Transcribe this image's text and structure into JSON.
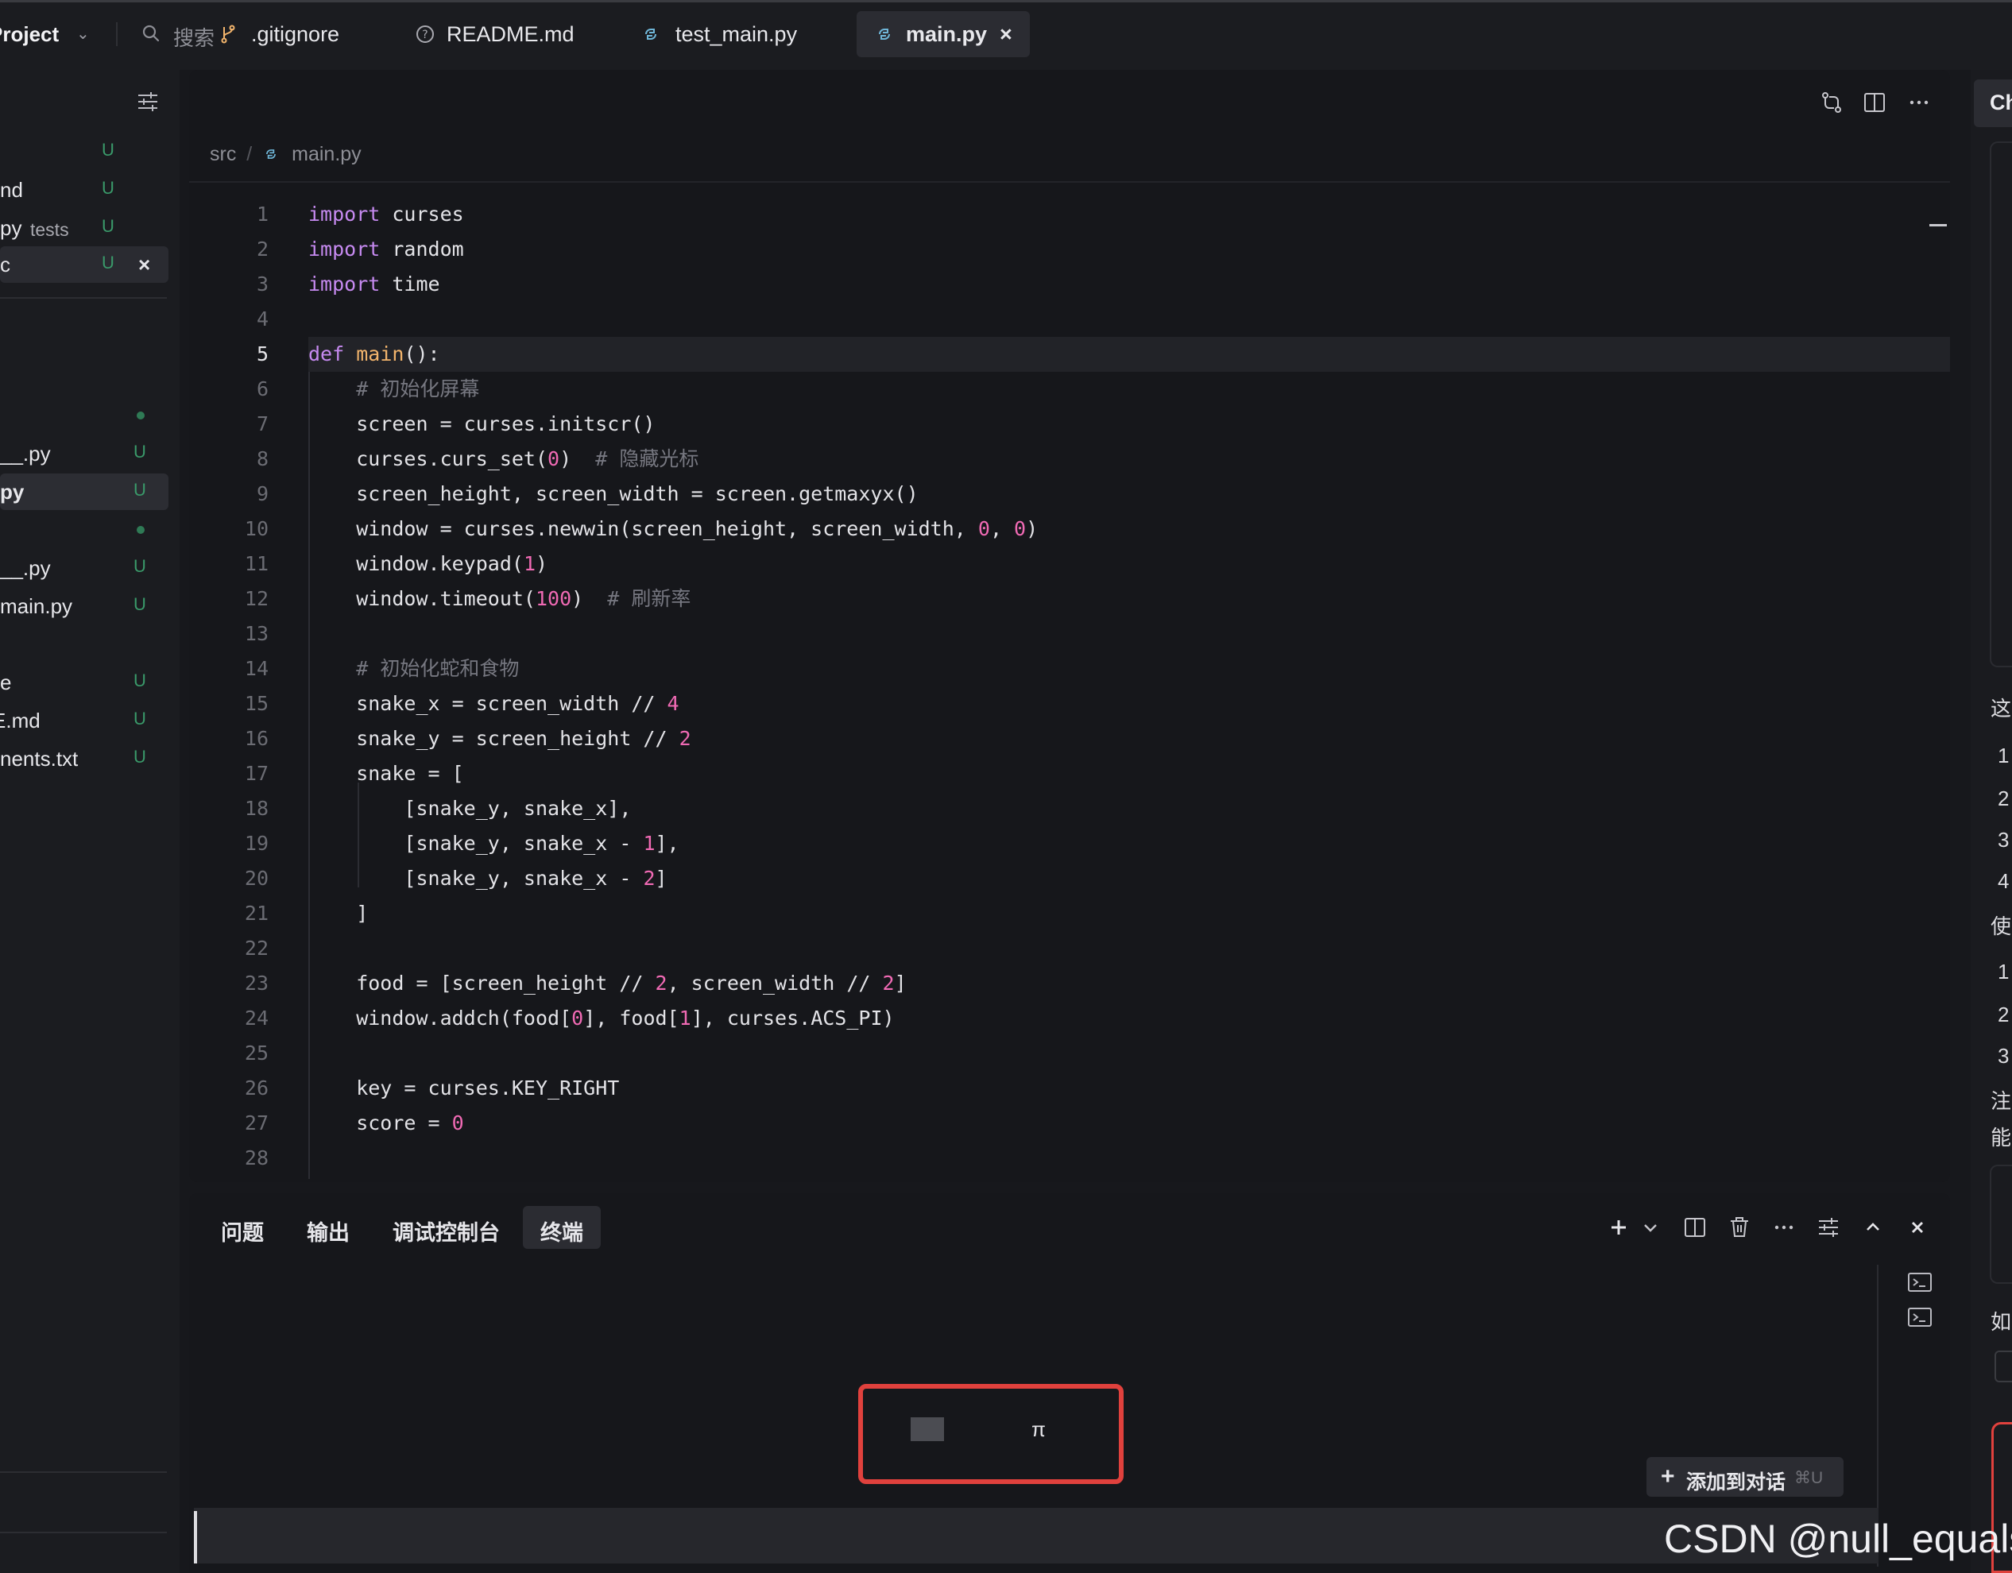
{
  "topbar": {
    "project": "Project",
    "search_placeholder": "搜索"
  },
  "sidebar": {
    "items": [
      {
        "name": "",
        "status": "U"
      },
      {
        "name": "nd",
        "status": "U"
      },
      {
        "name": "py",
        "sub": "tests",
        "status": "U"
      },
      {
        "name": "c",
        "status": "U",
        "close": "×"
      },
      {
        "name": "__.py",
        "status": "U"
      },
      {
        "name": "py",
        "status": "U"
      },
      {
        "name": "__.py",
        "status": "U"
      },
      {
        "name": "main.py",
        "status": "U"
      },
      {
        "name": "e",
        "status": "U"
      },
      {
        "name": "E.md",
        "status": "U"
      },
      {
        "name": "nents.txt",
        "status": "U"
      }
    ]
  },
  "editor": {
    "tabs": [
      {
        "label": ".gitignore",
        "icon": "git-branch-icon"
      },
      {
        "label": "README.md",
        "icon": "info-circle-icon"
      },
      {
        "label": "test_main.py",
        "icon": "python-icon"
      },
      {
        "label": "main.py",
        "icon": "python-icon",
        "close": "×"
      }
    ],
    "breadcrumb": {
      "folder": "src",
      "sep": "/",
      "file": "main.py"
    },
    "current_line": 5,
    "lines": [
      [
        {
          "t": "k",
          "v": "import"
        },
        {
          "t": "p",
          "v": " curses"
        }
      ],
      [
        {
          "t": "k",
          "v": "import"
        },
        {
          "t": "p",
          "v": " random"
        }
      ],
      [
        {
          "t": "k",
          "v": "import"
        },
        {
          "t": "p",
          "v": " time"
        }
      ],
      [],
      [
        {
          "t": "k",
          "v": "def"
        },
        {
          "t": "p",
          "v": " "
        },
        {
          "t": "f",
          "v": "main"
        },
        {
          "t": "p",
          "v": "():"
        }
      ],
      [
        {
          "t": "p",
          "v": "    "
        },
        {
          "t": "c",
          "v": "# 初始化屏幕"
        }
      ],
      [
        {
          "t": "p",
          "v": "    screen = curses.initscr()"
        }
      ],
      [
        {
          "t": "p",
          "v": "    curses.curs_set("
        },
        {
          "t": "n",
          "v": "0"
        },
        {
          "t": "p",
          "v": ")  "
        },
        {
          "t": "c",
          "v": "# 隐藏光标"
        }
      ],
      [
        {
          "t": "p",
          "v": "    screen_height, screen_width = screen.getmaxyx()"
        }
      ],
      [
        {
          "t": "p",
          "v": "    window = curses.newwin(screen_height, screen_width, "
        },
        {
          "t": "n",
          "v": "0"
        },
        {
          "t": "p",
          "v": ", "
        },
        {
          "t": "n",
          "v": "0"
        },
        {
          "t": "p",
          "v": ")"
        }
      ],
      [
        {
          "t": "p",
          "v": "    window.keypad("
        },
        {
          "t": "n",
          "v": "1"
        },
        {
          "t": "p",
          "v": ")"
        }
      ],
      [
        {
          "t": "p",
          "v": "    window.timeout("
        },
        {
          "t": "n",
          "v": "100"
        },
        {
          "t": "p",
          "v": ")  "
        },
        {
          "t": "c",
          "v": "# 刷新率"
        }
      ],
      [],
      [
        {
          "t": "p",
          "v": "    "
        },
        {
          "t": "c",
          "v": "# 初始化蛇和食物"
        }
      ],
      [
        {
          "t": "p",
          "v": "    snake_x = screen_width // "
        },
        {
          "t": "n",
          "v": "4"
        }
      ],
      [
        {
          "t": "p",
          "v": "    snake_y = screen_height // "
        },
        {
          "t": "n",
          "v": "2"
        }
      ],
      [
        {
          "t": "p",
          "v": "    snake = ["
        }
      ],
      [
        {
          "t": "p",
          "v": "        [snake_y, snake_x],"
        }
      ],
      [
        {
          "t": "p",
          "v": "        [snake_y, snake_x - "
        },
        {
          "t": "n",
          "v": "1"
        },
        {
          "t": "p",
          "v": "],"
        }
      ],
      [
        {
          "t": "p",
          "v": "        [snake_y, snake_x - "
        },
        {
          "t": "n",
          "v": "2"
        },
        {
          "t": "p",
          "v": "]"
        }
      ],
      [
        {
          "t": "p",
          "v": "    ]"
        }
      ],
      [],
      [
        {
          "t": "p",
          "v": "    food = [screen_height // "
        },
        {
          "t": "n",
          "v": "2"
        },
        {
          "t": "p",
          "v": ", screen_width // "
        },
        {
          "t": "n",
          "v": "2"
        },
        {
          "t": "p",
          "v": "]"
        }
      ],
      [
        {
          "t": "p",
          "v": "    window.addch(food["
        },
        {
          "t": "n",
          "v": "0"
        },
        {
          "t": "p",
          "v": "], food["
        },
        {
          "t": "n",
          "v": "1"
        },
        {
          "t": "p",
          "v": "], curses.ACS_PI)"
        }
      ],
      [],
      [
        {
          "t": "p",
          "v": "    key = curses.KEY_RIGHT"
        }
      ],
      [
        {
          "t": "p",
          "v": "    score = "
        },
        {
          "t": "n",
          "v": "0"
        }
      ],
      []
    ]
  },
  "panel": {
    "tabs": [
      "问题",
      "输出",
      "调试控制台",
      "终端"
    ],
    "active_tab": "终端",
    "terminal_output": "π",
    "add_to_chat": {
      "label": "添加到对话",
      "shortcut": "⌘U",
      "plus": "+"
    }
  },
  "chat_panel": {
    "tab_label": "Ch",
    "visible_chars": [
      "这",
      "1",
      "2",
      "3",
      "4",
      "使",
      "1",
      "2",
      "3",
      "注",
      "能",
      "如"
    ]
  },
  "watermark": "CSDN @null_equals",
  "colors": {
    "accent_red": "#e0413d",
    "status_untracked": "#3a9a6a",
    "keyword": "#c68af0",
    "function": "#f2b46c",
    "number": "#f06ab4"
  }
}
